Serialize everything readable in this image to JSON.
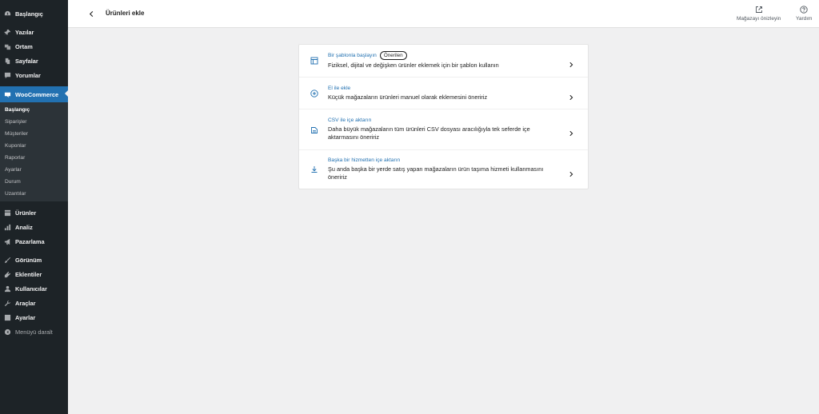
{
  "sidebar": {
    "top_items": [
      {
        "label": "Başlangıç",
        "icon": "dashboard-icon"
      },
      {
        "label": "Yazılar",
        "icon": "pin-icon"
      },
      {
        "label": "Ortam",
        "icon": "media-icon"
      },
      {
        "label": "Sayfalar",
        "icon": "pages-icon"
      },
      {
        "label": "Yorumlar",
        "icon": "comments-icon"
      }
    ],
    "woocommerce": {
      "label": "WooCommerce",
      "icon": "woocommerce-icon"
    },
    "woo_submenu": [
      "Başlangıç",
      "Siparişler",
      "Müşteriler",
      "Kuponlar",
      "Raporlar",
      "Ayarlar",
      "Durum",
      "Uzantılar"
    ],
    "mid_items": [
      {
        "label": "Ürünler",
        "icon": "products-icon"
      },
      {
        "label": "Analiz",
        "icon": "analytics-icon"
      },
      {
        "label": "Pazarlama",
        "icon": "megaphone-icon"
      }
    ],
    "bottom_items": [
      {
        "label": "Görünüm",
        "icon": "brush-icon"
      },
      {
        "label": "Eklentiler",
        "icon": "plugin-icon"
      },
      {
        "label": "Kullanıcılar",
        "icon": "users-icon"
      },
      {
        "label": "Araçlar",
        "icon": "wrench-icon"
      },
      {
        "label": "Ayarlar",
        "icon": "settings-icon"
      }
    ],
    "collapse_label": "Menüyü daralt"
  },
  "header": {
    "title": "Ürünleri ekle",
    "preview_label": "Mağazayı önizleyin",
    "help_label": "Yardım"
  },
  "options": [
    {
      "title": "Bir şablonla başlayın",
      "badge": "Önerilen",
      "description": "Fiziksel, dijital ve değişken ürünler eklemek için bir şablon kullanın",
      "icon": "template-icon"
    },
    {
      "title": "El ile ekle",
      "description": "Küçük mağazaların ürünleri manuel olarak eklemesini öneririz",
      "icon": "plus-circle-icon"
    },
    {
      "title": "CSV ile içe aktarın",
      "description": "Daha büyük mağazaların tüm ürünleri CSV dosyası aracılığıyla tek seferde içe aktarmasını öneririz",
      "icon": "csv-file-icon"
    },
    {
      "title": "Başka bir hizmetten içe aktarın",
      "description": "Şu anda başka bir yerde satış yapan mağazaların ürün taşıma hizmeti kullanmasını öneririz",
      "icon": "download-icon"
    }
  ],
  "colors": {
    "sidebar_bg": "#1d2327",
    "accent": "#2271b1",
    "page_bg": "#f0f0f1"
  }
}
